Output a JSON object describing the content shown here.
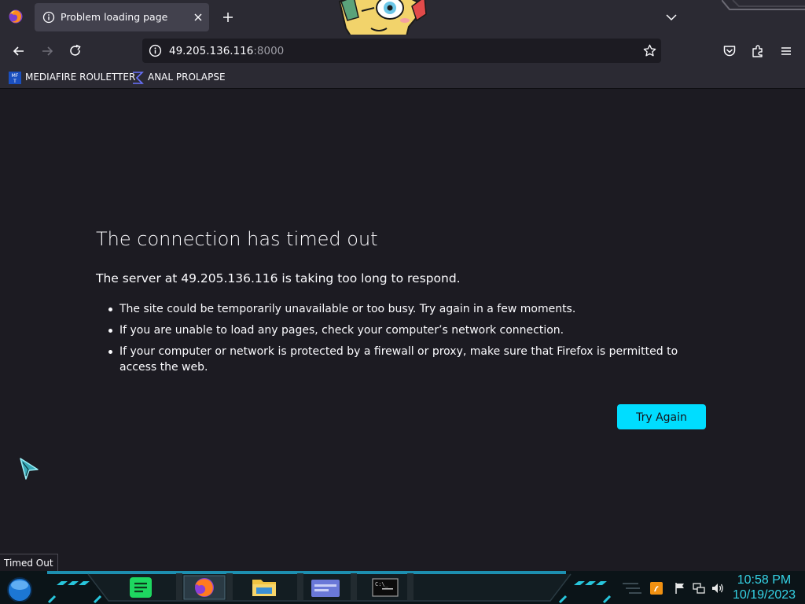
{
  "browser": {
    "tab": {
      "title": "Problem loading page"
    },
    "urlbar": {
      "host": "49.205.136.116",
      "port": ":8000"
    },
    "bookmarks": [
      {
        "label": "MEDIAFIRE ROULETTER",
        "icon": "mediafire-icon"
      },
      {
        "label": "ANAL PROLAPSE",
        "icon": "sigma-icon"
      }
    ]
  },
  "error": {
    "title": "The connection has timed out",
    "subtitle": "The server at 49.205.136.116 is taking too long to respond.",
    "reasons": [
      "The site could be temporarily unavailable or too busy. Try again in a few moments.",
      "If you are unable to load any pages, check your computer’s network connection.",
      "If your computer or network is protected by a firewall or proxy, make sure that Firefox is permitted to access the web."
    ],
    "button": "Try Again"
  },
  "status": {
    "text": "Timed Out"
  },
  "taskbar": {
    "apps": [
      "Spotify",
      "Firefox",
      "File Explorer",
      "Window",
      "Command Prompt"
    ],
    "clock": {
      "time": "10:58 PM",
      "date": "10/19/2023"
    }
  },
  "colors": {
    "accent": "#00ddff",
    "page_bg": "#1c1b22",
    "toolbar_bg": "#2b2a33",
    "clock": "#35d4e6"
  }
}
